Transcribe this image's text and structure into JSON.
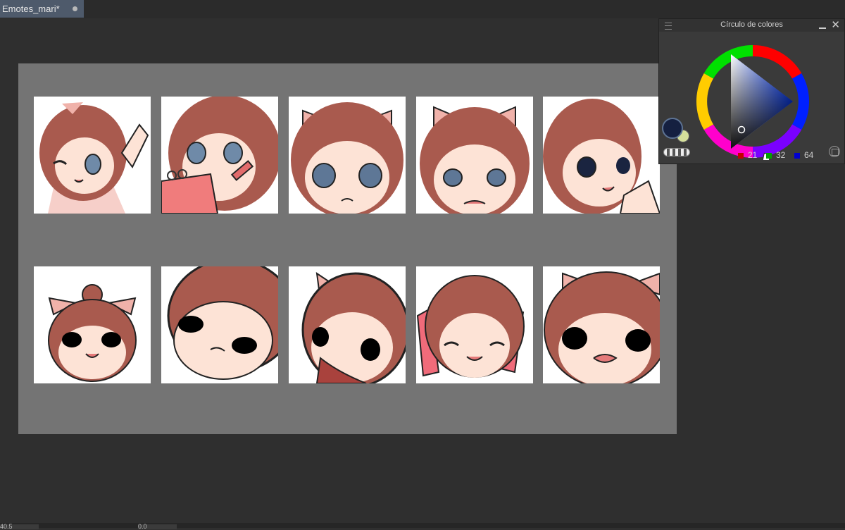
{
  "tab": {
    "title": "Emotes_mari*"
  },
  "color_panel": {
    "title": "Círculo de colores",
    "rgb": {
      "r": "21",
      "g": "32",
      "b": "64"
    },
    "colors": {
      "main": "#152040",
      "sub": "#d5e09b",
      "red": "#c00000",
      "green": "#00a000",
      "blue": "#0000d0"
    }
  },
  "status": {
    "zoom": "40.5",
    "angle": "0.0"
  },
  "colors": {
    "canvas": "#747474",
    "workspace": "#2f2f2f",
    "tab_active": "#4e5a6b"
  }
}
